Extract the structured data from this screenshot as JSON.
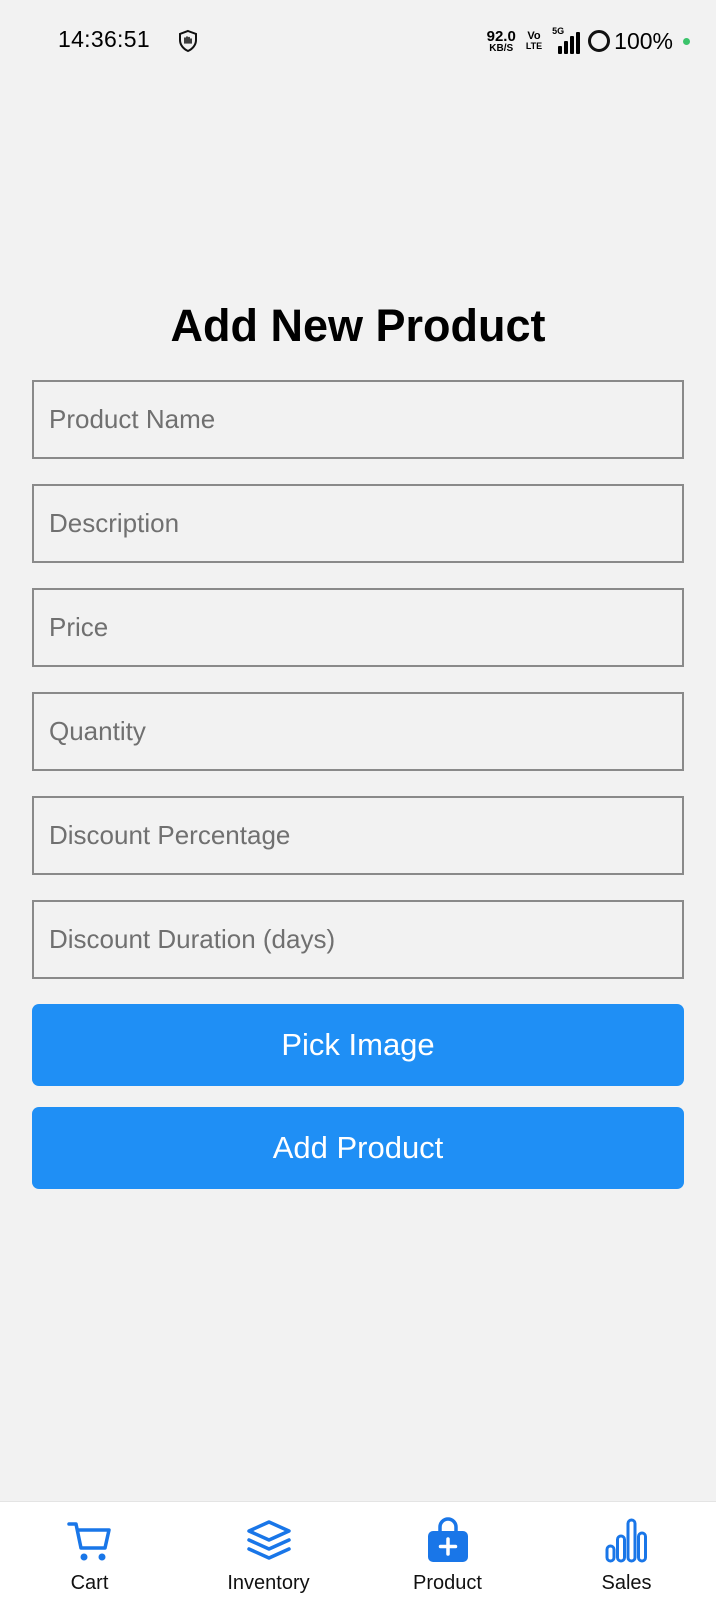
{
  "status_bar": {
    "time": "14:36:51",
    "net_speed_value": "92.0",
    "net_speed_unit": "KB/S",
    "volte_top": "Vo",
    "volte_bottom": "LTE",
    "network_type": "5G",
    "battery": "100%",
    "colors": {
      "charging_dot": "#3bc36b"
    }
  },
  "page": {
    "title": "Add New Product"
  },
  "form": {
    "fields": [
      {
        "name": "product-name-input",
        "placeholder": "Product Name",
        "value": ""
      },
      {
        "name": "description-input",
        "placeholder": "Description",
        "value": ""
      },
      {
        "name": "price-input",
        "placeholder": "Price",
        "value": ""
      },
      {
        "name": "quantity-input",
        "placeholder": "Quantity",
        "value": ""
      },
      {
        "name": "discount-percentage-input",
        "placeholder": "Discount Percentage",
        "value": ""
      },
      {
        "name": "discount-duration-input",
        "placeholder": "Discount Duration (days)",
        "value": ""
      }
    ],
    "pick_image_label": "Pick Image",
    "add_product_label": "Add Product",
    "colors": {
      "button_bg": "#1f8ff5",
      "button_text": "#ffffff"
    }
  },
  "bottom_nav": {
    "items": [
      {
        "label": "Cart",
        "icon": "cart-icon"
      },
      {
        "label": "Inventory",
        "icon": "layers-icon"
      },
      {
        "label": "Product",
        "icon": "bag-plus-icon"
      },
      {
        "label": "Sales",
        "icon": "bar-chart-icon"
      }
    ],
    "colors": {
      "icon": "#1976e8"
    }
  }
}
